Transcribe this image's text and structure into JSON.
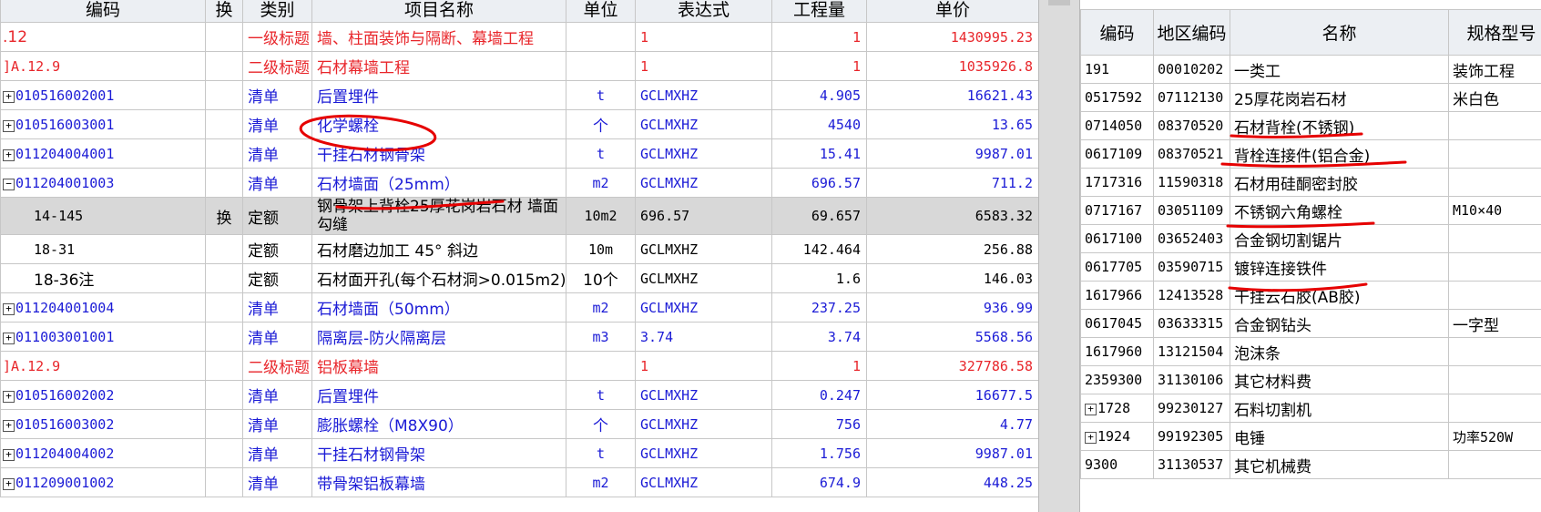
{
  "left": {
    "headers": [
      "编码",
      "换",
      "类别",
      "项目名称",
      "单位",
      "表达式",
      "工程量",
      "单价"
    ],
    "rows": [
      {
        "code": ".12",
        "swap": "",
        "cat": "一级标题",
        "name": "墙、柱面装饰与隔断、幕墙工程",
        "unit": "",
        "expr": "1",
        "qty": "1",
        "price": "1430995.23"
      },
      {
        "code": "]A.12.9",
        "swap": "",
        "cat": "二级标题",
        "name": "石材幕墙工程",
        "unit": "",
        "expr": "1",
        "qty": "1",
        "price": "1035926.8"
      },
      {
        "code": "010516002001",
        "swap": "",
        "cat": "清单",
        "name": "后置埋件",
        "unit": "t",
        "expr": "GCLMXHZ",
        "qty": "4.905",
        "price": "16621.43"
      },
      {
        "code": "010516003001",
        "swap": "",
        "cat": "清单",
        "name": "化学螺栓",
        "unit": "个",
        "expr": "GCLMXHZ",
        "qty": "4540",
        "price": "13.65"
      },
      {
        "code": "011204004001",
        "swap": "",
        "cat": "清单",
        "name": "干挂石材钢骨架",
        "unit": "t",
        "expr": "GCLMXHZ",
        "qty": "15.41",
        "price": "9987.01"
      },
      {
        "code": "011204001003",
        "swap": "",
        "cat": "清单",
        "name": "石材墙面（25mm）",
        "unit": "m2",
        "expr": "GCLMXHZ",
        "qty": "696.57",
        "price": "711.2"
      },
      {
        "code": "14-145",
        "swap": "换",
        "cat": "定额",
        "name": "钢骨架上背栓25厚花岗岩石材 墙面勾缝",
        "unit": "10m2",
        "expr": "696.57",
        "qty": "69.657",
        "price": "6583.32"
      },
      {
        "code": "18-31",
        "swap": "",
        "cat": "定额",
        "name": "石材磨边加工 45° 斜边",
        "unit": "10m",
        "expr": "GCLMXHZ",
        "qty": "142.464",
        "price": "256.88"
      },
      {
        "code": "18-36注",
        "swap": "",
        "cat": "定额",
        "name": "石材面开孔(每个石材洞>0.015m2)",
        "unit": "10个",
        "expr": "GCLMXHZ",
        "qty": "1.6",
        "price": "146.03"
      },
      {
        "code": "011204001004",
        "swap": "",
        "cat": "清单",
        "name": "石材墙面（50mm）",
        "unit": "m2",
        "expr": "GCLMXHZ",
        "qty": "237.25",
        "price": "936.99"
      },
      {
        "code": "011003001001",
        "swap": "",
        "cat": "清单",
        "name": "隔离层-防火隔离层",
        "unit": "m3",
        "expr": "3.74",
        "qty": "3.74",
        "price": "5568.56"
      },
      {
        "code": "]A.12.9",
        "swap": "",
        "cat": "二级标题",
        "name": "铝板幕墙",
        "unit": "",
        "expr": "1",
        "qty": "1",
        "price": "327786.58"
      },
      {
        "code": "010516002002",
        "swap": "",
        "cat": "清单",
        "name": "后置埋件",
        "unit": "t",
        "expr": "GCLMXHZ",
        "qty": "0.247",
        "price": "16677.5"
      },
      {
        "code": "010516003002",
        "swap": "",
        "cat": "清单",
        "name": "膨胀螺栓（M8X90）",
        "unit": "个",
        "expr": "GCLMXHZ",
        "qty": "756",
        "price": "4.77"
      },
      {
        "code": "011204004002",
        "swap": "",
        "cat": "清单",
        "name": "干挂石材钢骨架",
        "unit": "t",
        "expr": "GCLMXHZ",
        "qty": "1.756",
        "price": "9987.01"
      },
      {
        "code": "011209001002",
        "swap": "",
        "cat": "清单",
        "name": "带骨架铝板幕墙",
        "unit": "m2",
        "expr": "GCLMXHZ",
        "qty": "674.9",
        "price": "448.25"
      }
    ]
  },
  "right": {
    "headers": [
      "编码",
      "地区编码",
      "名称",
      "规格型号"
    ],
    "rows": [
      {
        "code": "191",
        "area": "00010202",
        "name": "一类工",
        "spec": "装饰工程"
      },
      {
        "code": "0517592",
        "area": "07112130",
        "name": "25厚花岗岩石材",
        "spec": "米白色"
      },
      {
        "code": "0714050",
        "area": "08370520",
        "name": "石材背栓(不锈钢)",
        "spec": ""
      },
      {
        "code": "0617109",
        "area": "08370521",
        "name": "背栓连接件(铝合金)",
        "spec": ""
      },
      {
        "code": "1717316",
        "area": "11590318",
        "name": "石材用硅酮密封胶",
        "spec": ""
      },
      {
        "code": "0717167",
        "area": "03051109",
        "name": "不锈钢六角螺栓",
        "spec": "M10×40"
      },
      {
        "code": "0617100",
        "area": "03652403",
        "name": "合金钢切割锯片",
        "spec": ""
      },
      {
        "code": "0617705",
        "area": "03590715",
        "name": "镀锌连接铁件",
        "spec": ""
      },
      {
        "code": "1617966",
        "area": "12413528",
        "name": "干挂云石胶(AB胶)",
        "spec": ""
      },
      {
        "code": "0617045",
        "area": "03633315",
        "name": "合金钢钻头",
        "spec": "一字型"
      },
      {
        "code": "1617960",
        "area": "13121504",
        "name": "泡沫条",
        "spec": ""
      },
      {
        "code": "2359300",
        "area": "31130106",
        "name": "其它材料费",
        "spec": ""
      },
      {
        "code": "1728",
        "area": "99230127",
        "name": "石料切割机",
        "spec": ""
      },
      {
        "code": "1924",
        "area": "99192305",
        "name": "电锤",
        "spec": "功率520W"
      },
      {
        "code": "9300",
        "area": "31130537",
        "name": "其它机械费",
        "spec": ""
      }
    ]
  },
  "colors": {
    "title_red": "#e8262b",
    "list_blue": "#1b1bd6",
    "annotation_red": "#e60000"
  }
}
